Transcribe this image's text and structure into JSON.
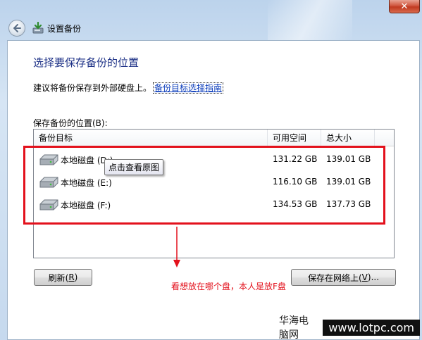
{
  "window": {
    "title": "设置备份",
    "close_glyph": "✕"
  },
  "page": {
    "heading": "选择要保存备份的位置",
    "advice_text": "建议将备份保存到外部硬盘上。",
    "advice_link": "备份目标选择指南",
    "list_label": "保存备份的位置(B):"
  },
  "table": {
    "columns": [
      "备份目标",
      "可用空间",
      "总大小"
    ],
    "rows": [
      {
        "name": "本地磁盘 (D:)",
        "free": "131.22 GB",
        "total": "139.01 GB",
        "icon": "hard-drive-icon"
      },
      {
        "name": "本地磁盘 (E:)",
        "free": "116.10 GB",
        "total": "139.01 GB",
        "icon": "hard-drive-icon"
      },
      {
        "name": "本地磁盘 (F:)",
        "free": "134.53 GB",
        "total": "137.73 GB",
        "icon": "hard-drive-icon"
      }
    ]
  },
  "tooltip": "点击查看原图",
  "annotation": {
    "note": "看想放在哪个盘，本人是放F盘",
    "color": "#e3111c"
  },
  "buttons": {
    "refresh_pre": "刷新(",
    "refresh_key": "R",
    "refresh_post": ")",
    "network_pre": "保存在网络上(",
    "network_key": "V",
    "network_post": ")..."
  },
  "watermark": {
    "cn": "华海电脑网",
    "url": "www.lotpc.com"
  },
  "colors": {
    "heading": "#1e3287",
    "link": "#0b3cbb",
    "accent_red": "#e3111c"
  }
}
